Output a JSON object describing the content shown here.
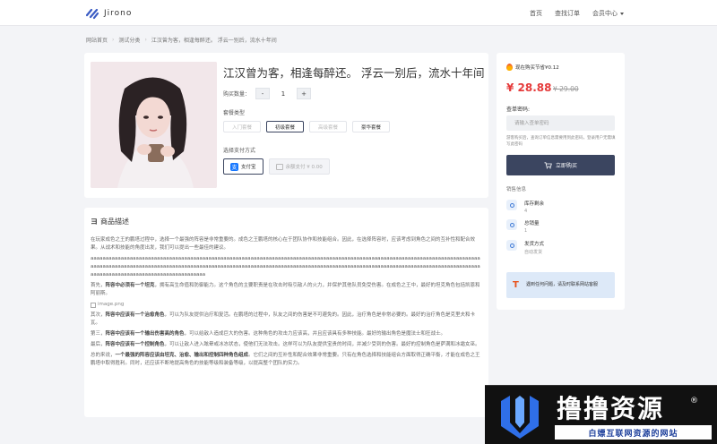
{
  "brand": {
    "name": "Jirono"
  },
  "nav": {
    "home": "首页",
    "query": "查找订单",
    "member": "会员中心"
  },
  "breadcrumb": [
    "网站首页",
    "测试分类",
    "江汉曾为客，相逢每醉还。 浮云一别后，流水十年间"
  ],
  "product": {
    "title": "江汉曾为客，相逢每醉还。 浮云一别后，流水十年间",
    "qty_label": "购买数量：",
    "qty_minus": "-",
    "qty_value": "1",
    "qty_plus": "+",
    "package_label": "套餐类型",
    "packages": [
      "入门套餐",
      "初级套餐",
      "高级套餐",
      "豪华套餐"
    ],
    "pay_label": "选择支付方式",
    "pay_alipay": "支付宝",
    "pay_balance": "余额支付 ¥ 0.00"
  },
  "description": {
    "heading": "商品描述",
    "p1": "在玩家成色之王的鹏塔过程中，选择一个最强的阵容是非常重要的。成色之王鹏塔的核心在于团队协作和技能组合。因此，在选择阵容时，应该考虑到角色之间的互补性和配合效果。从战术和技能的角度出发，我们可以提出一些最佳的建议。",
    "p2": "aaaaaaaaaaaaaaaaaaaaaaaaaaaaaaaaaaaaaaaaaaaaaaaaaaaaaaaaaaaaaaaaaaaaaaaaaaaaaaaaaaaaaaaaaaaaaaaaaaaaaaaaaaaaaaaaaaaaaaaaaaaaaaaaaaaaaaaaaaaaaaaaaaaaaaaaaaaaaaaaaaaaaaaaaaaaaaaaaaaaaaaaaaaaaaaaaaaaaaaaaaaaaaaaaaaaaaaaaaaaaaaaaaaaaaaaaaaaaaaaaaaaaaaaaaaaaaaaaaaaaaaaaaaaaaaaaaaaaaaaaaaaaaaaaaaaaaaa",
    "p3_pre": "首先，",
    "p3_bold": "阵容中必须有一个坦克",
    "p3_post": "，拥有高生命值和防御能力。这个角色的主要职责是在攻击时吸引敌人的火力，并保护其他队员免受伤害。在成色之王中，最好的坦克角色包括凯恩和阿丽斯。",
    "img_alt": "image.png",
    "p4_pre": "其次，",
    "p4_bold": "阵容中应该有一个治愈角色",
    "p4_post": "，可以为队友提供治疗和复活。在鹏塔的过程中，队友之间的伤害是不可避免的。因此，治疗角色是非常必要的。最好的治疗角色是克里夫和卡瓦。",
    "p5_pre": "第三，",
    "p5_bold": "阵容中应该有一个输出伤害高的角色",
    "p5_post": "，可以给敌人造成巨大的伤害。这种角色的攻击力应该高，并且应该具有多种技能。最好的输出角色是魔法士和狂战士。",
    "p6_pre": "最后，",
    "p6_bold": "阵容中应该有一个控制角色",
    "p6_post": "，可以让敌人进入眩晕或冰冻状态，使他们无法攻击。这样可以为队友提供宝贵的时间，并减少受到的伤害。最好的控制角色是萨满和冰霜女巫。",
    "p7_pre": "总的来说，",
    "p7_bold": "一个最强的阵容应该由坦克、治愈、输出和控制四种角色组成",
    "p7_post": "。它们之间的互补性和配合效果非常重要。只有在角色选择和技能组合方面取得正确平衡，才能在成色之王鹏塔中取得胜利。同时，还应该不断地提高角色的技能等级和装备等级，以提高整个团队的实力。"
  },
  "sidebar": {
    "save_text": "现在购买节省¥0.12",
    "price": "¥ 28.88",
    "original_price": "¥ 29.00",
    "query_label": "查单密码:",
    "query_placeholder": "请输入查单密码",
    "query_help": "游客购买后，查询订单信息需要用到此密码，登录用户无需填写此密码",
    "buy_button": "立即购买",
    "sales_label": "销售信息",
    "stock_title": "库存剩余",
    "stock_value": "4",
    "sold_title": "总销量",
    "sold_value": "1",
    "ship_title": "发货方式",
    "ship_value": "自动发货",
    "help_text": "遇到任何问题，请及时联系网站客服"
  },
  "banner": {
    "title": "撸撸资源",
    "reg": "®",
    "subtitle": "白嫖互联网资源的网站"
  },
  "colors": {
    "accent": "#3b4560",
    "price": "#e53a3a",
    "help_bg": "#dde9f8"
  }
}
